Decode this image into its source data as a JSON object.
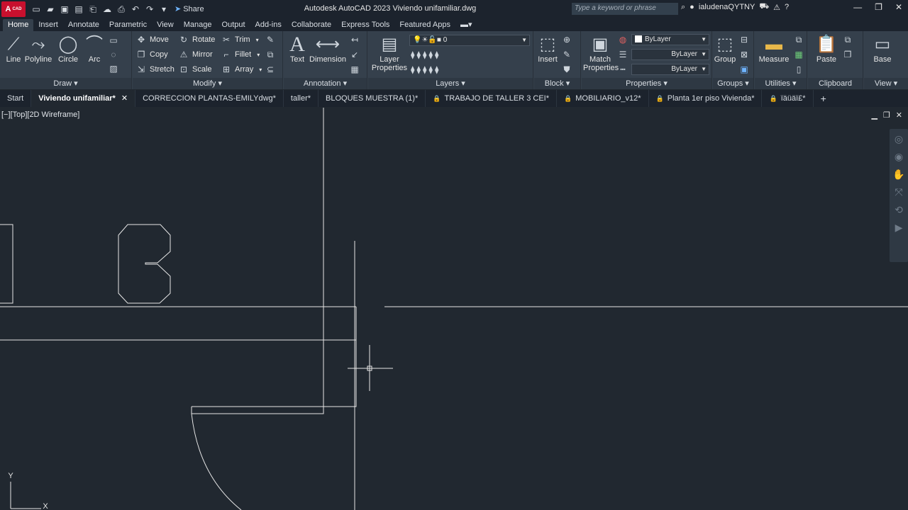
{
  "title_bar": {
    "logo_text": "A",
    "logo_sub": "CAD",
    "share_label": "Share",
    "app_title": "Autodesk AutoCAD 2023    Viviendo unifamiliar.dwg",
    "search_placeholder": "Type a keyword or phrase",
    "user_name": "ialudenaQYTNY"
  },
  "ribbon_tabs": [
    "Home",
    "Insert",
    "Annotate",
    "Parametric",
    "View",
    "Manage",
    "Output",
    "Add-ins",
    "Collaborate",
    "Express Tools",
    "Featured Apps"
  ],
  "ribbon": {
    "draw": {
      "title": "Draw",
      "line": "Line",
      "polyline": "Polyline",
      "circle": "Circle",
      "arc": "Arc"
    },
    "modify": {
      "title": "Modify",
      "move": "Move",
      "rotate": "Rotate",
      "trim": "Trim",
      "copy": "Copy",
      "mirror": "Mirror",
      "fillet": "Fillet",
      "stretch": "Stretch",
      "scale": "Scale",
      "array": "Array"
    },
    "annotation": {
      "title": "Annotation",
      "text": "Text",
      "dimension": "Dimension"
    },
    "layers": {
      "title": "Layers",
      "layer_properties_1": "Layer",
      "layer_properties_2": "Properties",
      "current_layer": "0"
    },
    "block": {
      "title": "Block",
      "insert": "Insert"
    },
    "properties": {
      "title": "Properties",
      "match_1": "Match",
      "match_2": "Properties",
      "color": "ByLayer",
      "lineweight": "ByLayer",
      "linetype": "ByLayer"
    },
    "groups": {
      "title": "Groups",
      "group": "Group"
    },
    "utilities": {
      "title": "Utilities",
      "measure": "Measure"
    },
    "clipboard": {
      "title": "Clipboard",
      "paste": "Paste"
    },
    "view": {
      "title": "View",
      "base": "Base"
    }
  },
  "doc_tabs": [
    {
      "label": "Start",
      "locked": false,
      "active": false
    },
    {
      "label": "Viviendo unifamiliar*",
      "locked": false,
      "active": true
    },
    {
      "label": "CORRECCION PLANTAS-EMILYdwg*",
      "locked": false,
      "active": false
    },
    {
      "label": "taller*",
      "locked": false,
      "active": false
    },
    {
      "label": "BLOQUES MUESTRA (1)*",
      "locked": false,
      "active": false
    },
    {
      "label": "TRABAJO DE TALLER 3 CEI*",
      "locked": true,
      "active": false
    },
    {
      "label": "MOBILIARIO_v12*",
      "locked": true,
      "active": false
    },
    {
      "label": "Planta 1er piso Vivienda*",
      "locked": true,
      "active": false
    },
    {
      "label": "ïäüäï£*",
      "locked": true,
      "active": false
    }
  ],
  "canvas": {
    "viewport_label": "[−][Top][2D Wireframe]",
    "ucs_y": "Y",
    "ucs_x": "X",
    "drawing_numeral": "3"
  },
  "colors": {
    "ribbon_bg": "#35404c",
    "canvas_bg": "#212830",
    "title_bg": "#1c232d",
    "line": "#e6e6e6"
  }
}
